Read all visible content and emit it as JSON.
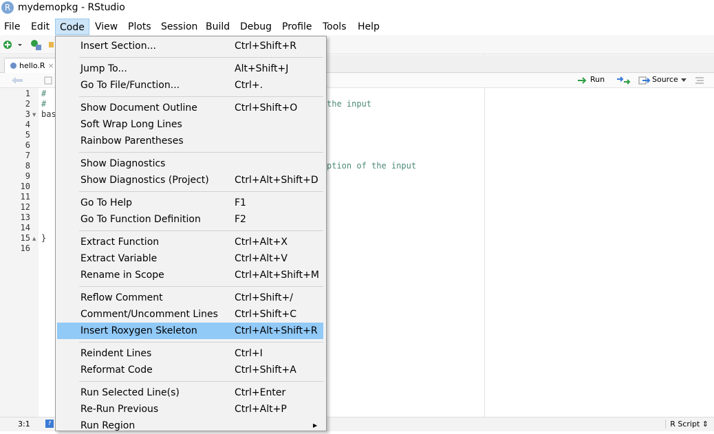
{
  "window": {
    "title": "mydemopkg - RStudio",
    "app_icon": "R"
  },
  "menubar": [
    "File",
    "Edit",
    "Code",
    "View",
    "Plots",
    "Session",
    "Build",
    "Debug",
    "Profile",
    "Tools",
    "Help"
  ],
  "editor": {
    "tab_label": "hello.R",
    "toolbar": {
      "run": "Run",
      "source": "Source"
    },
    "line_numbers": [
      "1",
      "2",
      "3",
      "4",
      "5",
      "6",
      "7",
      "8",
      "9",
      "10",
      "11",
      "12",
      "13",
      "14",
      "15",
      "16"
    ],
    "code_lines": [
      {
        "text": "# ",
        "kind": "comment"
      },
      {
        "text": "# ",
        "kind": "comment"
      },
      {
        "text": "bas",
        "kind": "code"
      },
      {
        "text": "  ",
        "kind": "code"
      },
      {
        "text": "  ",
        "kind": "code"
      },
      {
        "text": "  ",
        "kind": "code"
      },
      {
        "text": "  ",
        "kind": "code"
      },
      {
        "text": "  ",
        "kind": "code"
      },
      {
        "text": "  ",
        "kind": "code"
      },
      {
        "text": "",
        "kind": "code"
      },
      {
        "text": "",
        "kind": "code"
      },
      {
        "text": "",
        "kind": "code"
      },
      {
        "text": "",
        "kind": "code"
      },
      {
        "text": "  ",
        "kind": "code"
      },
      {
        "text": "}",
        "kind": "code"
      },
      {
        "text": "",
        "kind": "code"
      }
    ],
    "visible_fragments": [
      "the input",
      "ption of the input"
    ],
    "cursor_position": "3:1",
    "file_type": "R Script"
  },
  "code_menu": {
    "groups": [
      [
        {
          "label": "Insert Section...",
          "shortcut": "Ctrl+Shift+R"
        }
      ],
      [
        {
          "label": "Jump To...",
          "shortcut": "Alt+Shift+J"
        },
        {
          "label": "Go To File/Function...",
          "shortcut": "Ctrl+."
        }
      ],
      [
        {
          "label": "Show Document Outline",
          "shortcut": "Ctrl+Shift+O"
        },
        {
          "label": "Soft Wrap Long Lines",
          "shortcut": ""
        },
        {
          "label": "Rainbow Parentheses",
          "shortcut": ""
        }
      ],
      [
        {
          "label": "Show Diagnostics",
          "shortcut": ""
        },
        {
          "label": "Show Diagnostics (Project)",
          "shortcut": "Ctrl+Alt+Shift+D"
        }
      ],
      [
        {
          "label": "Go To Help",
          "shortcut": "F1"
        },
        {
          "label": "Go To Function Definition",
          "shortcut": "F2"
        }
      ],
      [
        {
          "label": "Extract Function",
          "shortcut": "Ctrl+Alt+X"
        },
        {
          "label": "Extract Variable",
          "shortcut": "Ctrl+Alt+V"
        },
        {
          "label": "Rename in Scope",
          "shortcut": "Ctrl+Alt+Shift+M"
        }
      ],
      [
        {
          "label": "Reflow Comment",
          "shortcut": "Ctrl+Shift+/"
        },
        {
          "label": "Comment/Uncomment Lines",
          "shortcut": "Ctrl+Shift+C"
        },
        {
          "label": "Insert Roxygen Skeleton",
          "shortcut": "Ctrl+Alt+Shift+R",
          "highlighted": true
        }
      ],
      [
        {
          "label": "Reindent Lines",
          "shortcut": "Ctrl+I"
        },
        {
          "label": "Reformat Code",
          "shortcut": "Ctrl+Shift+A"
        }
      ],
      [
        {
          "label": "Run Selected Line(s)",
          "shortcut": "Ctrl+Enter"
        },
        {
          "label": "Re-Run Previous",
          "shortcut": "Ctrl+Alt+P"
        },
        {
          "label": "Run Region",
          "shortcut": "",
          "submenu": true
        }
      ]
    ]
  },
  "colors": {
    "menu_highlight": "#91c9f7",
    "comment": "#4d8a79",
    "active_menu": "#cce4f7"
  }
}
